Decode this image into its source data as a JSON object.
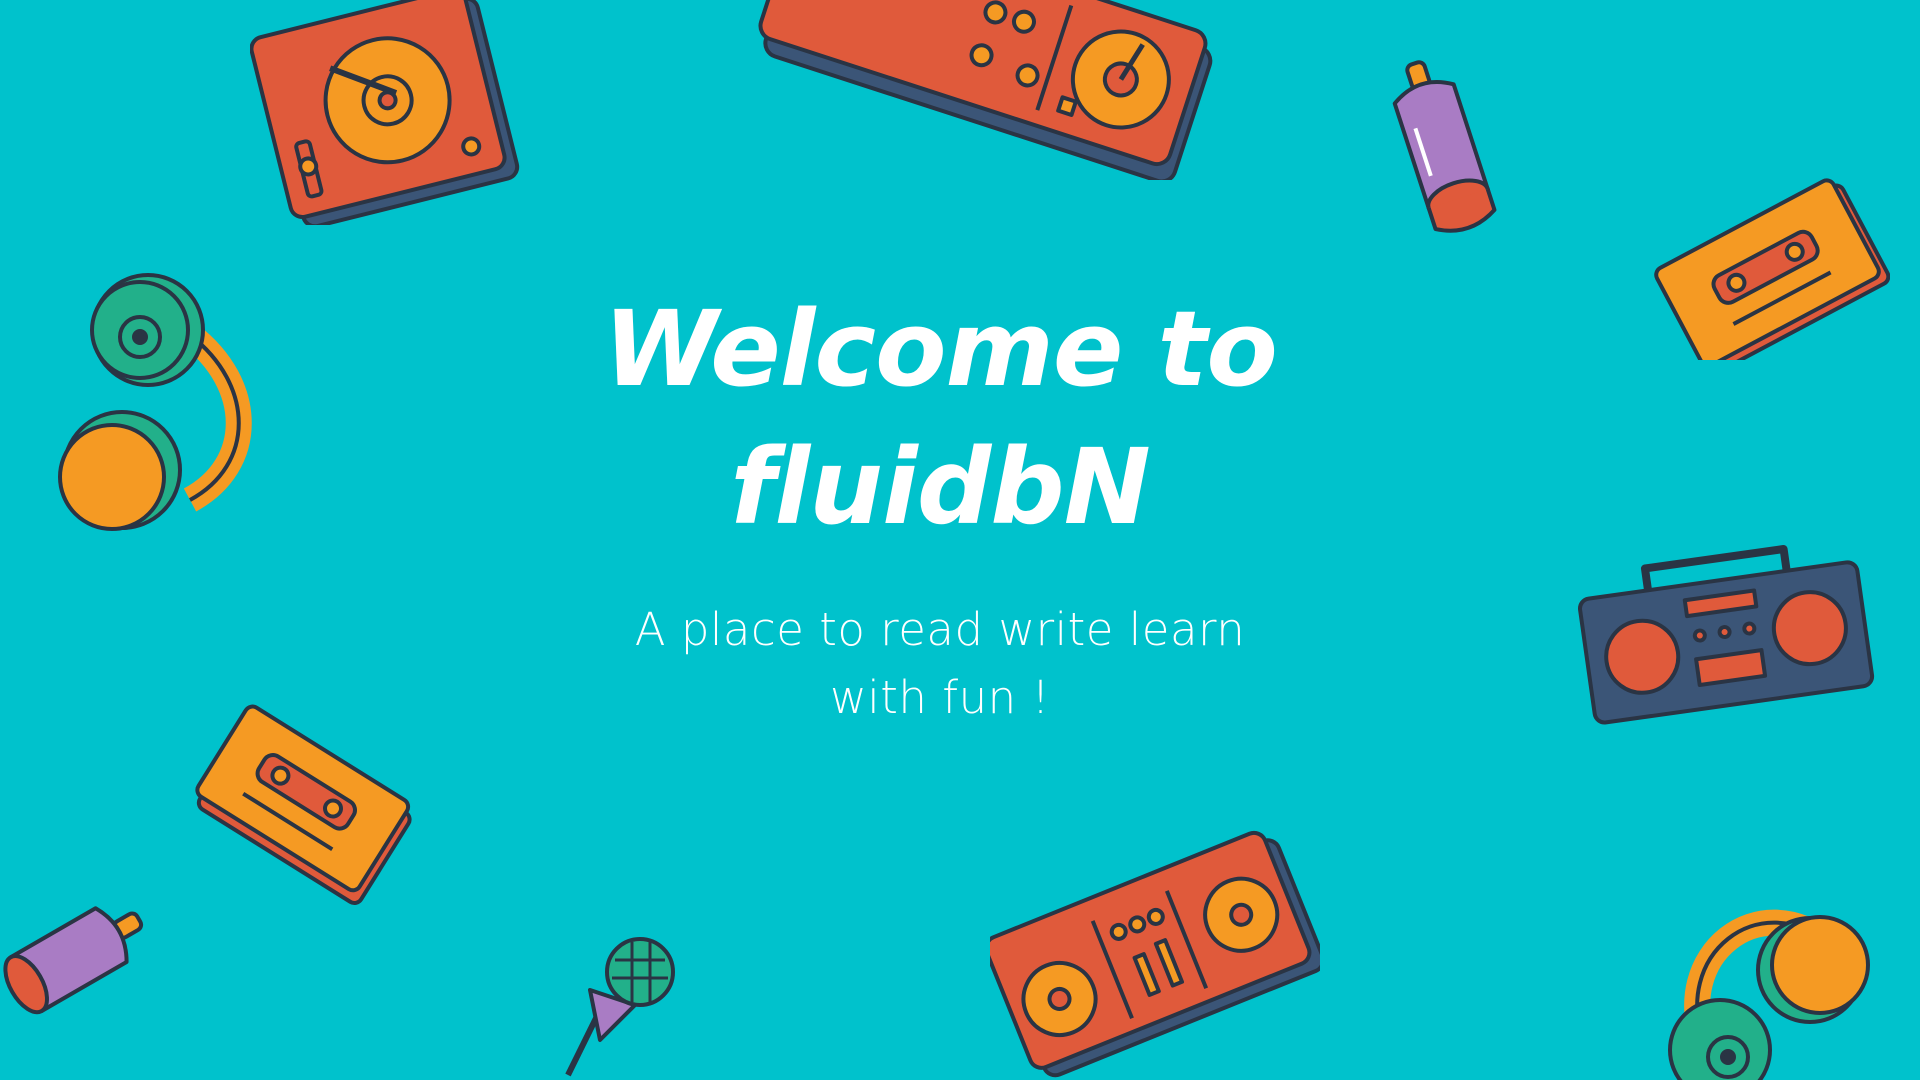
{
  "colors": {
    "background": "#00c2cc",
    "orange_red": "#e05a3b",
    "orange": "#f59a23",
    "navy": "#3b5577",
    "purple": "#a97cc4",
    "teal": "#22b08a",
    "outline": "#2a3444",
    "text": "#ffffff"
  },
  "hero": {
    "title_line1": "Welcome to",
    "title_line2": "fluidbN",
    "subtitle_line1": "A place to read write learn",
    "subtitle_line2": "with fun !"
  },
  "decorations": [
    "turntable-icon",
    "dj-mixer-icon",
    "spray-can-icon",
    "cassette-tape-icon",
    "headphones-icon",
    "boombox-icon",
    "microphone-icon"
  ]
}
